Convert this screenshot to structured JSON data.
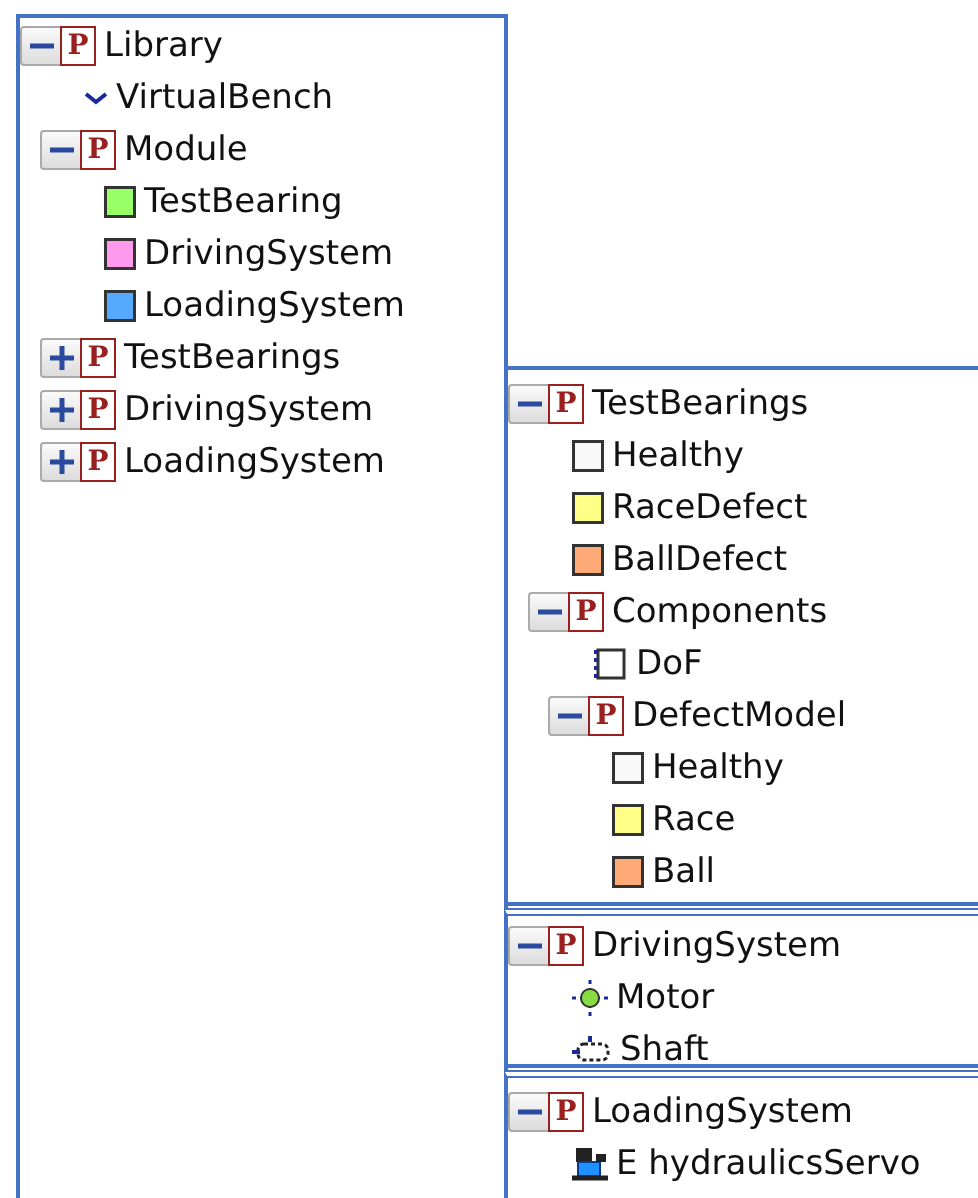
{
  "panels": [
    {
      "nodes": [
        {
          "kind": "package",
          "letter": "P",
          "label": "Library",
          "expanded": true,
          "children": [
            {
              "kind": "bench",
              "label": "VirtualBench"
            },
            {
              "kind": "package",
              "letter": "P",
              "label": "Module",
              "expanded": true,
              "children": [
                {
                  "kind": "block",
                  "label": "TestBearing",
                  "color": "#99ff66"
                },
                {
                  "kind": "block",
                  "label": "DrivingSystem",
                  "color": "#ff99ee"
                },
                {
                  "kind": "block",
                  "label": "LoadingSystem",
                  "color": "#55aaff"
                }
              ]
            },
            {
              "kind": "package",
              "letter": "P",
              "label": "TestBearings",
              "expanded": false
            },
            {
              "kind": "package",
              "letter": "P",
              "label": "DrivingSystem",
              "expanded": false
            },
            {
              "kind": "package",
              "letter": "P",
              "label": "LoadingSystem",
              "expanded": false
            }
          ]
        }
      ]
    },
    {
      "nodes": [
        {
          "kind": "package",
          "letter": "P",
          "label": "TestBearings",
          "expanded": true,
          "children": [
            {
              "kind": "block",
              "label": "Healthy",
              "color": "#f8f8f8"
            },
            {
              "kind": "block",
              "label": "RaceDefect",
              "color": "#ffff88"
            },
            {
              "kind": "block",
              "label": "BallDefect",
              "color": "#ffaa77"
            },
            {
              "kind": "package",
              "letter": "P",
              "label": "Components",
              "expanded": true,
              "children": [
                {
                  "kind": "dof",
                  "label": "DoF"
                },
                {
                  "kind": "package",
                  "letter": "P",
                  "label": "DefectModel",
                  "expanded": true,
                  "children": [
                    {
                      "kind": "block",
                      "label": "Healthy",
                      "color": "#f8f8f8"
                    },
                    {
                      "kind": "block",
                      "label": "Race",
                      "color": "#ffff88"
                    },
                    {
                      "kind": "block",
                      "label": "Ball",
                      "color": "#ffaa77"
                    }
                  ]
                }
              ]
            }
          ]
        }
      ]
    },
    {
      "nodes": [
        {
          "kind": "package",
          "letter": "P",
          "label": "DrivingSystem",
          "expanded": true,
          "children": [
            {
              "kind": "motor",
              "label": "Motor"
            },
            {
              "kind": "shaft",
              "label": "Shaft"
            }
          ]
        }
      ]
    },
    {
      "nodes": [
        {
          "kind": "package",
          "letter": "P",
          "label": "LoadingSystem",
          "expanded": true,
          "children": [
            {
              "kind": "servo",
              "label": "E hydraulicsServo"
            }
          ]
        }
      ]
    }
  ]
}
